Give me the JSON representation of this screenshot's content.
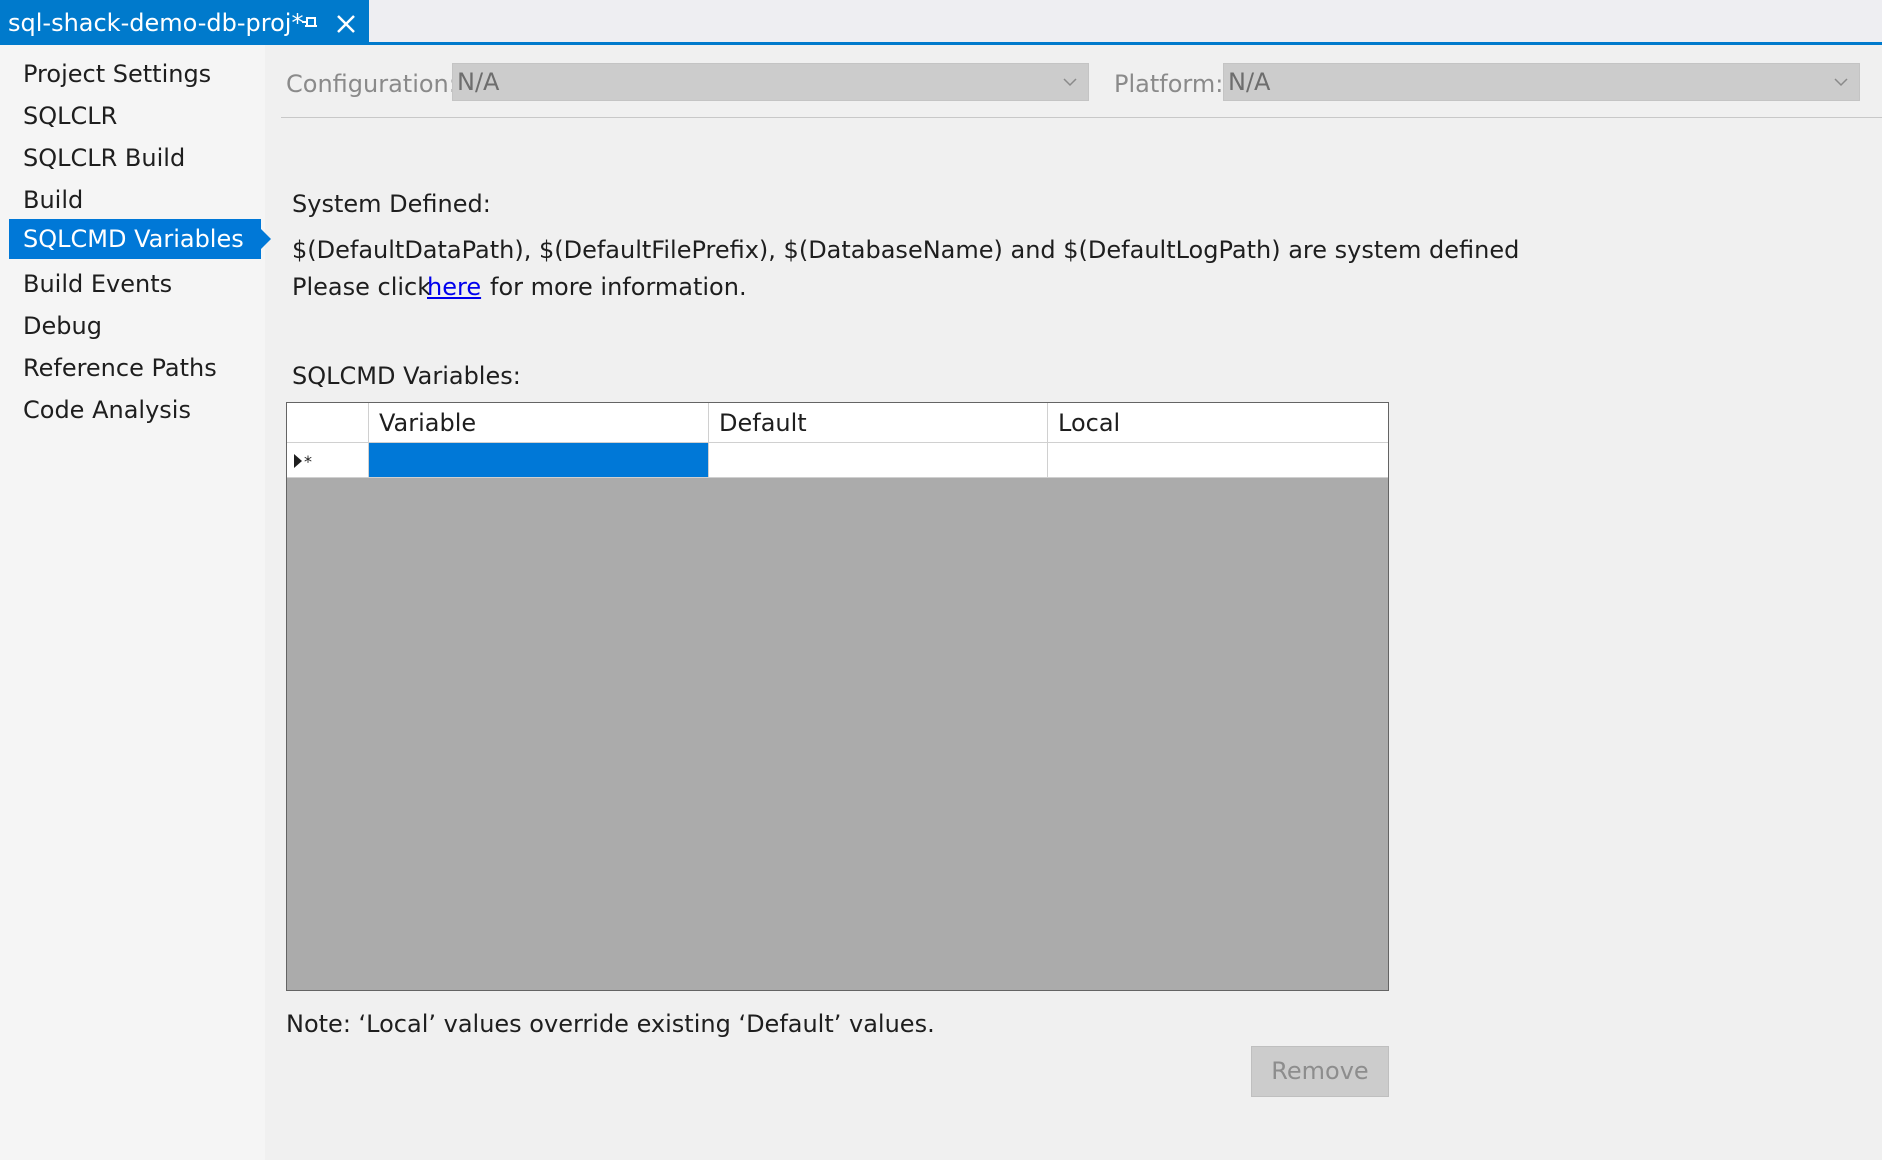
{
  "tab": {
    "title": "sql-shack-demo-db-proj*",
    "pin_icon": "pin-icon",
    "close_icon": "close-icon"
  },
  "sidebar": {
    "items": [
      {
        "label": "Project Settings",
        "selected": false
      },
      {
        "label": "SQLCLR",
        "selected": false
      },
      {
        "label": "SQLCLR Build",
        "selected": false
      },
      {
        "label": "Build",
        "selected": false
      },
      {
        "label": "SQLCMD Variables",
        "selected": true
      },
      {
        "label": "Build Events",
        "selected": false
      },
      {
        "label": "Debug",
        "selected": false
      },
      {
        "label": "Reference Paths",
        "selected": false
      },
      {
        "label": "Code Analysis",
        "selected": false
      }
    ]
  },
  "config": {
    "configuration_label": "Configuration:",
    "configuration_value": "N/A",
    "platform_label": "Platform:",
    "platform_value": "N/A"
  },
  "system_defined": {
    "heading": "System Defined:",
    "description": "$(DefaultDataPath), $(DefaultFilePrefix), $(DatabaseName) and $(DefaultLogPath) are system defined",
    "click_prefix": "Please click",
    "link_text": "here",
    "click_suffix": "for more information."
  },
  "variables": {
    "heading": "SQLCMD Variables:",
    "columns": [
      "Variable",
      "Default",
      "Local"
    ],
    "new_row_marker": "▶*",
    "rows": []
  },
  "note": "Note: ‘Local’ values override existing ‘Default’ values.",
  "remove_label": "Remove",
  "colors": {
    "accent": "#007acc",
    "selection": "#0078d7",
    "grid_empty": "#ababab",
    "link": "#0000ee"
  }
}
